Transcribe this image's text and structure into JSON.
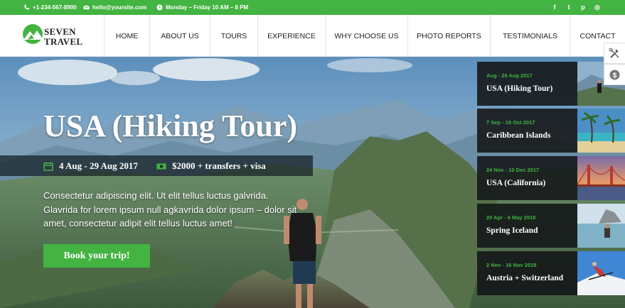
{
  "topbar": {
    "phone": "+1-234-567-8900",
    "email": "hello@yoursite.com",
    "hours": "Monday – Friday 10 AM – 8 PM",
    "social": [
      {
        "icon": "facebook-icon",
        "glyph": "f"
      },
      {
        "icon": "twitter-icon",
        "glyph": "t"
      },
      {
        "icon": "pinterest-icon",
        "glyph": "p"
      },
      {
        "icon": "instagram-icon",
        "glyph": "◎"
      }
    ]
  },
  "brand": {
    "line1": "SEVEN",
    "line2": "TRAVEL"
  },
  "nav": [
    "HOME",
    "ABOUT US",
    "TOURS",
    "EXPERIENCE",
    "WHY CHOOSE US",
    "PHOTO REPORTS",
    "TESTIMONIALS",
    "CONTACT"
  ],
  "hero": {
    "title": "USA (Hiking Tour)",
    "dates": "4 Aug - 29 Aug 2017",
    "price": "$2000 + transfers + visa",
    "description": "Consectetur adipiscing elit. Ut elit tellus luctus galvrida. Glavrida for lorem ipsum null agkavrida dolor ipsum – dolor sit amet, consectetur adipit elit tellus luctus amet!",
    "cta": "Book your trip!"
  },
  "tours": [
    {
      "date": "Aug - 29 Aug 2017",
      "name": "USA (Hiking Tour)"
    },
    {
      "date": "7 Sep - 19 Oct 2017",
      "name": "Caribbean Islands"
    },
    {
      "date": "24 Nov - 10 Dec 2017",
      "name": "USA (California)"
    },
    {
      "date": "20 Apr - 6 May 2018",
      "name": "Spring Iceland"
    },
    {
      "date": "2 Nov - 16 Nov 2018",
      "name": "Austria + Switzerland"
    }
  ],
  "widgets": [
    {
      "icon": "tools-icon"
    },
    {
      "icon": "dollar-icon"
    }
  ],
  "colors": {
    "accent": "#43b341",
    "dark_panel": "#121416"
  }
}
